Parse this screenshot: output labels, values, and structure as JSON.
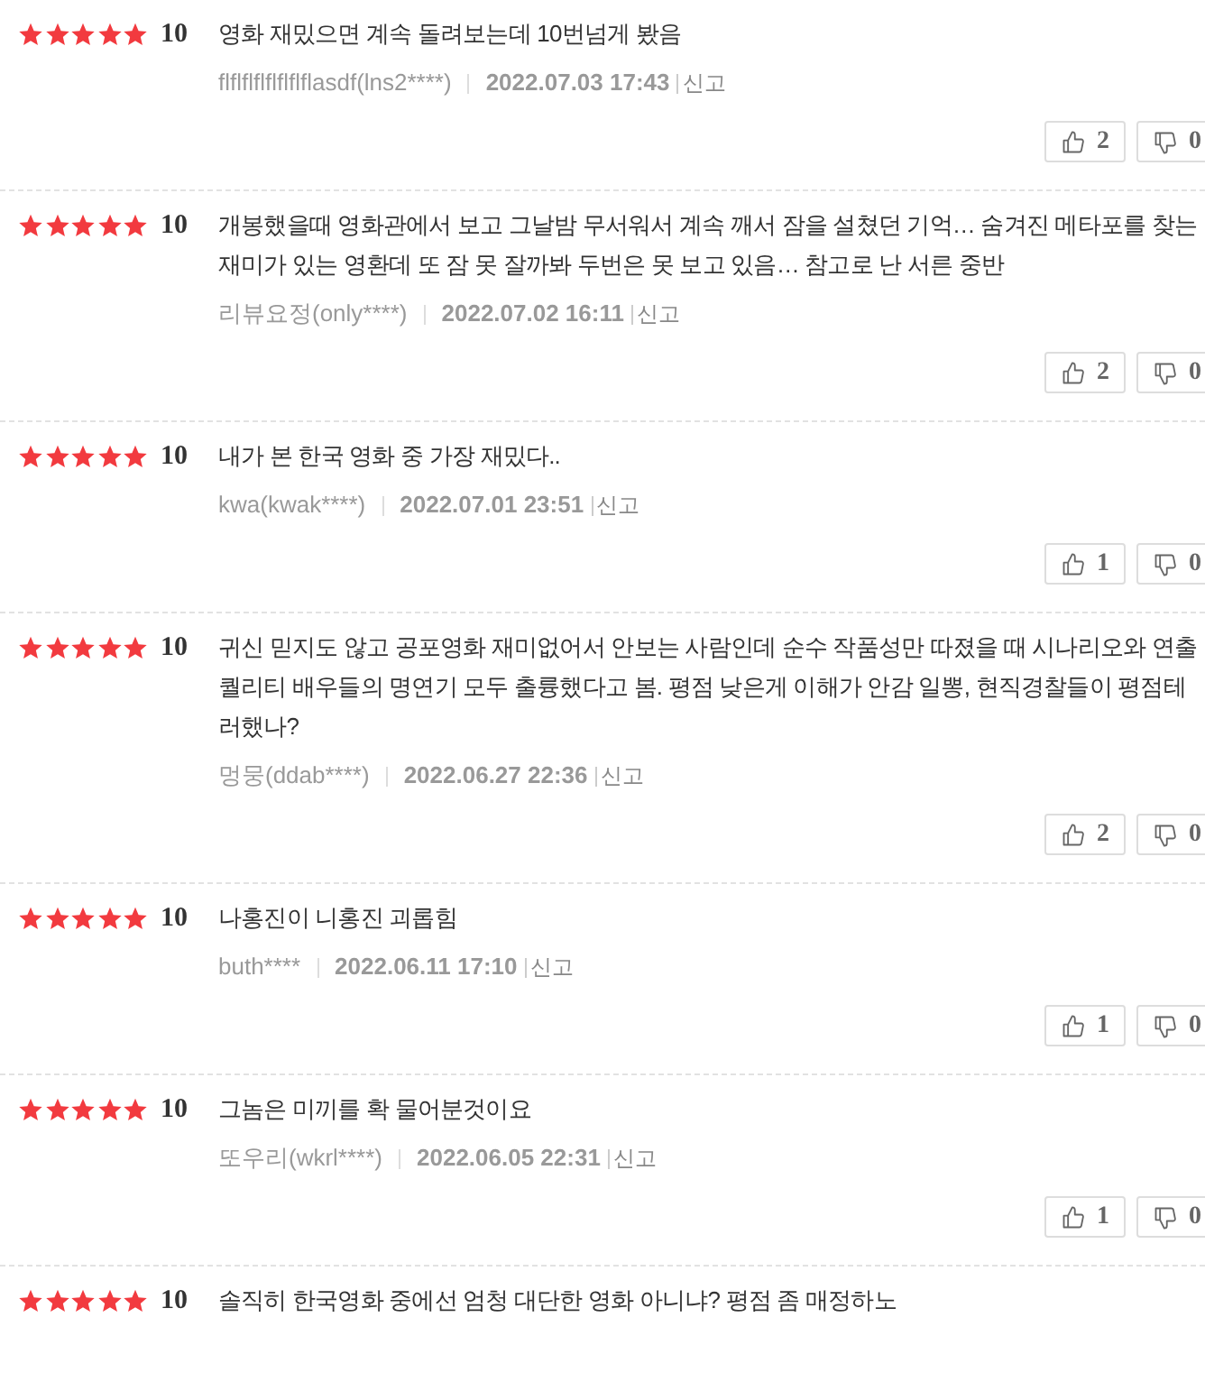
{
  "reviews": [
    {
      "stars": 5,
      "score": "10",
      "text": "영화 재밌으면 계속 돌려보는데 10번넘게 봤음",
      "user": "flflflflflflflflasdf(lns2****)",
      "date": "2022.07.03 17:43",
      "report": "신고",
      "likes": "2",
      "dislikes": "0"
    },
    {
      "stars": 5,
      "score": "10",
      "text": "개봉했을때 영화관에서 보고 그날밤 무서워서 계속 깨서 잠을 설쳤던 기억… 숨겨진 메타포를 찾는\n재미가 있는 영환데 또 잠 못 잘까봐 두번은 못 보고 있음… 참고로 난 서른 중반",
      "user": "리뷰요정(only****)",
      "date": "2022.07.02 16:11",
      "report": "신고",
      "likes": "2",
      "dislikes": "0"
    },
    {
      "stars": 5,
      "score": "10",
      "text": "내가 본 한국 영화 중 가장 재밌다..",
      "user": "kwa(kwak****)",
      "date": "2022.07.01 23:51",
      "report": "신고",
      "likes": "1",
      "dislikes": "0"
    },
    {
      "stars": 5,
      "score": "10",
      "text": "귀신 믿지도 않고 공포영화 재미없어서 안보는 사람인데 순수 작품성만 따졌을 때 시나리오와 연출\n퀄리티 배우들의 명연기 모두 출륭했다고 봄. 평점 낮은게 이해가 안감 일뽕, 현직경찰들이 평점테\n러했나?",
      "user": "멍뭉(ddab****)",
      "date": "2022.06.27 22:36",
      "report": "신고",
      "likes": "2",
      "dislikes": "0"
    },
    {
      "stars": 5,
      "score": "10",
      "text": "나홍진이 니홍진 괴롭힘",
      "user": "buth****",
      "date": "2022.06.11 17:10",
      "report": "신고",
      "likes": "1",
      "dislikes": "0"
    },
    {
      "stars": 5,
      "score": "10",
      "text": "그놈은 미끼를 확 물어분것이요",
      "user": "또우리(wkrl****)",
      "date": "2022.06.05 22:31",
      "report": "신고",
      "likes": "1",
      "dislikes": "0"
    },
    {
      "stars": 5,
      "score": "10",
      "text": "솔직히 한국영화 중에선 엄청 대단한 영화 아니냐? 평점 좀 매정하노"
    }
  ]
}
